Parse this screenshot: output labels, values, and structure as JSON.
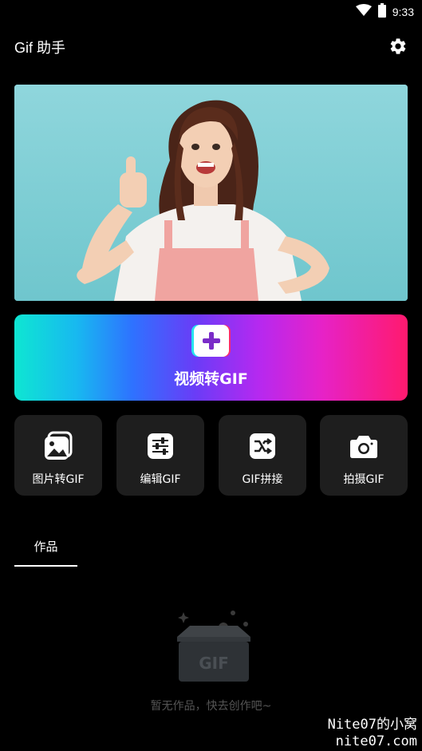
{
  "status_bar": {
    "time": "9:33"
  },
  "app_bar": {
    "title": "Gif 助手",
    "settings_icon": "gear-icon"
  },
  "hero": {
    "image_icon": "hero-photo"
  },
  "primary_action": {
    "label": "视频转GIF",
    "icon": "plus-icon"
  },
  "tools": [
    {
      "label": "图片转GIF",
      "icon": "images-icon"
    },
    {
      "label": "编辑GIF",
      "icon": "sliders-icon"
    },
    {
      "label": "GIF拼接",
      "icon": "merge-icon"
    },
    {
      "label": "拍摄GIF",
      "icon": "camera-icon"
    }
  ],
  "tabs": [
    {
      "label": "作品",
      "selected": true
    }
  ],
  "empty_state": {
    "text": "暂无作品，快去创作吧~"
  },
  "watermark": {
    "line1": "Nite07的小窝",
    "line2": "nite07.com"
  },
  "colors": {
    "background": "#000000",
    "card": "#1e1e1e",
    "gradient_start": "#0ee6d2",
    "gradient_end": "#ff1a6e"
  }
}
